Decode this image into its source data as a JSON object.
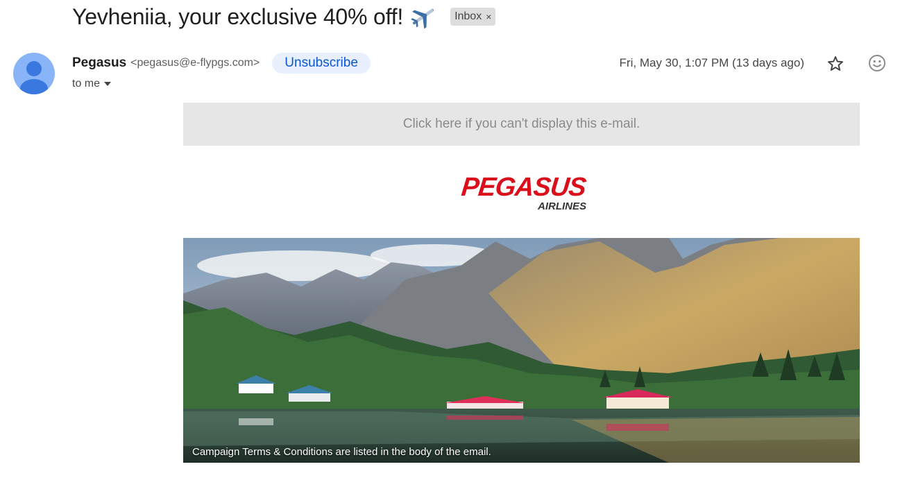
{
  "email": {
    "subject": "Yevheniia, your exclusive 40% off!",
    "subject_emoji_icon": "airplane-icon",
    "label_chip": "Inbox",
    "label_chip_close": "×",
    "sender": {
      "name": "Pegasus",
      "email": "<pegasus@e-flypgs.com>",
      "avatar_icon": "person-avatar-icon"
    },
    "unsubscribe_label": "Unsubscribe",
    "recipient_label": "to me",
    "date": "Fri, May 30, 1:07 PM (13 days ago)",
    "actions": [
      "star-icon",
      "emoji-reaction-icon"
    ]
  },
  "body": {
    "display_link": "Click here if you can't display this e-mail.",
    "logo": {
      "brand": "PEGASUS",
      "sub": "AIRLINES"
    },
    "hero": {
      "caption": "Campaign Terms & Conditions are listed in the body of the email."
    }
  },
  "colors": {
    "brand_red": "#d9101c",
    "unsubscribe_bg": "#e8f0fe",
    "unsubscribe_text": "#0b57d0",
    "avatar_bg": "#8ab4f8"
  }
}
